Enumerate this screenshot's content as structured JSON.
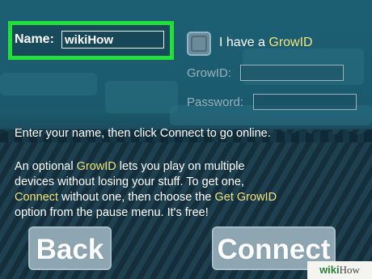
{
  "name_row": {
    "label": "Name:",
    "value": "wikiHow"
  },
  "growid_toggle": {
    "prefix": "I have a ",
    "highlight": "GrowID",
    "checked": false
  },
  "growid_field": {
    "label": "GrowID:",
    "value": ""
  },
  "password_field": {
    "label": "Password:",
    "value": ""
  },
  "instruction": "Enter your name, then click Connect to go online.",
  "info": {
    "l1a": "An optional ",
    "l1b": "GrowID",
    "l1c": " lets you play on multiple",
    "l2": "devices without losing your stuff.  To get one,",
    "l3a": "Connect",
    "l3b": " without one, then choose the ",
    "l3c": "Get GrowID",
    "l4": "option from the pause menu.  It's free!"
  },
  "buttons": {
    "back": "Back",
    "connect": "Connect"
  },
  "watermark": {
    "brand": "wiki",
    "suffix": "How"
  },
  "colors": {
    "highlight_box": "#22e03a",
    "accent_text": "#f2e47a"
  }
}
